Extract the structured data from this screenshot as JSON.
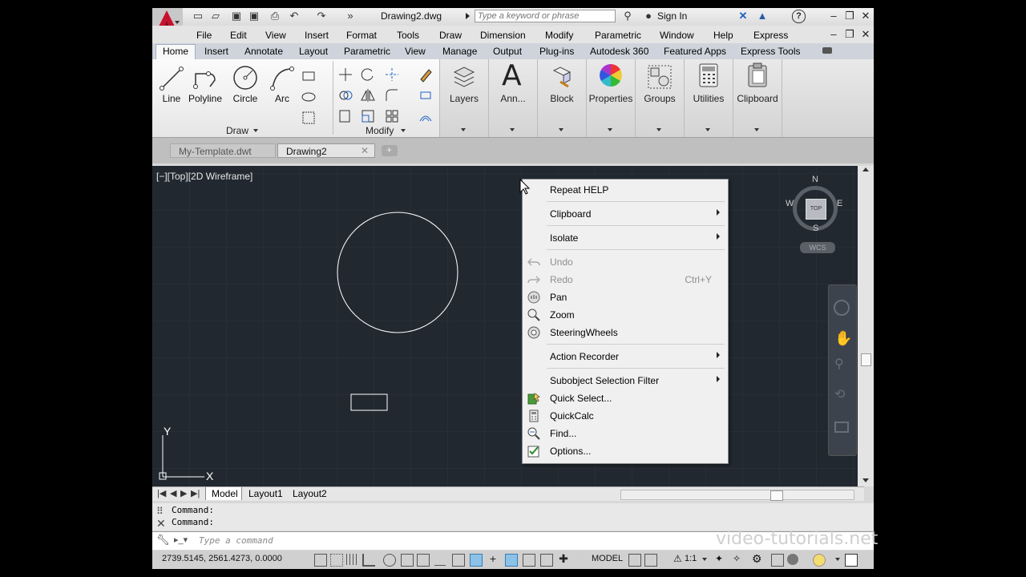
{
  "title_bar": {
    "document_title": "Drawing2.dwg",
    "search_placeholder": "Type a keyword or phrase",
    "sign_in": "Sign In",
    "help_icon": "?"
  },
  "menu_bar": [
    "File",
    "Edit",
    "View",
    "Insert",
    "Format",
    "Tools",
    "Draw",
    "Dimension",
    "Modify",
    "Parametric",
    "Window",
    "Help",
    "Express"
  ],
  "ribbon_tabs": [
    "Home",
    "Insert",
    "Annotate",
    "Layout",
    "Parametric",
    "View",
    "Manage",
    "Output",
    "Plug-ins",
    "Autodesk 360",
    "Featured Apps",
    "Express Tools"
  ],
  "ribbon": {
    "draw_tools": [
      "Line",
      "Polyline",
      "Circle",
      "Arc"
    ],
    "draw_panel_title": "Draw",
    "modify_panel_title": "Modify",
    "big_panels": [
      "Layers",
      "Ann...",
      "Block",
      "Properties",
      "Groups",
      "Utilities",
      "Clipboard"
    ]
  },
  "doc_tabs": [
    "My-Template.dwt",
    "Drawing2"
  ],
  "viewport": {
    "label": "[−][Top][2D Wireframe]",
    "viewcube": {
      "n": "N",
      "s": "S",
      "e": "E",
      "w": "W",
      "center": "TOP",
      "wcs": "WCS"
    },
    "ucs": {
      "x": "X",
      "y": "Y"
    }
  },
  "context_menu": {
    "items": [
      {
        "label": "Repeat HELP"
      },
      {
        "label": "Clipboard"
      },
      {
        "label": "Isolate"
      },
      {
        "label": "Undo"
      },
      {
        "label": "Redo",
        "shortcut": "Ctrl+Y"
      },
      {
        "label": "Pan"
      },
      {
        "label": "Zoom"
      },
      {
        "label": "SteeringWheels"
      },
      {
        "label": "Action Recorder"
      },
      {
        "label": "Subobject Selection Filter"
      },
      {
        "label": "Quick Select..."
      },
      {
        "label": "QuickCalc"
      },
      {
        "label": "Find..."
      },
      {
        "label": "Options..."
      }
    ]
  },
  "layout_tabs": [
    "Model",
    "Layout1",
    "Layout2"
  ],
  "command": {
    "history": [
      "Command:",
      "Command:"
    ],
    "placeholder": "Type a command"
  },
  "status_bar": {
    "coordinates": "2739.5145, 2561.4273, 0.0000",
    "model": "MODEL",
    "scale": "1:1"
  },
  "watermark": "video-tutorials.net"
}
